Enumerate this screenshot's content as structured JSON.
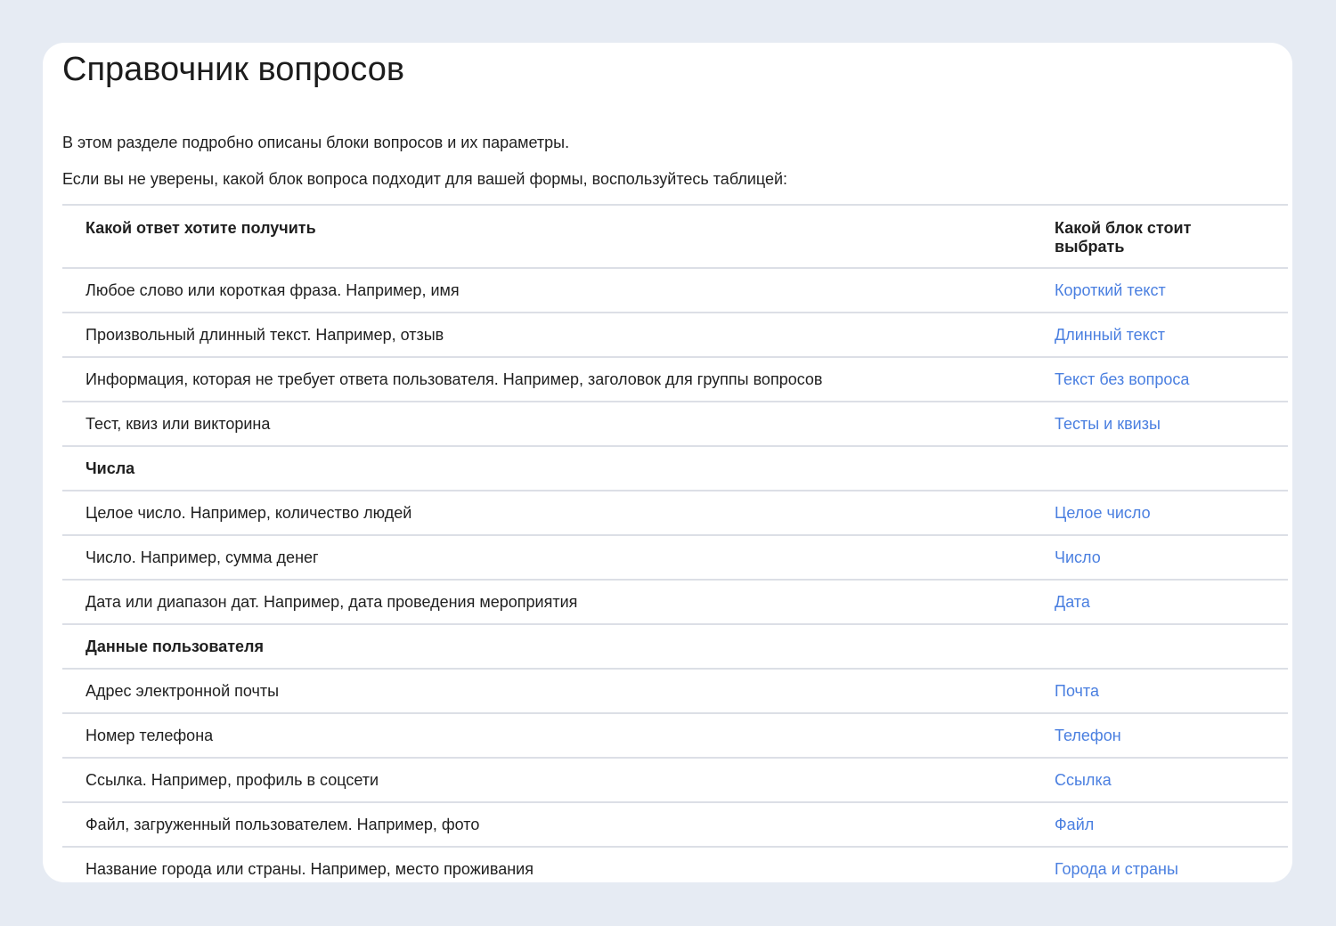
{
  "page": {
    "title": "Справочник вопросов",
    "intro": "В этом разделе подробно описаны блоки вопросов и их параметры.",
    "hint": "Если вы не уверены, какой блок вопроса подходит для вашей формы, воспользуйтесь таблицей:"
  },
  "table": {
    "headers": [
      "Какой ответ хотите получить",
      "Какой блок стоит выбрать"
    ],
    "rows": [
      {
        "answer": "Любое слово или короткая фраза. Например, имя",
        "block": "Короткий текст"
      },
      {
        "answer": "Произвольный длинный текст. Например, отзыв",
        "block": "Длинный текст"
      },
      {
        "answer": "Информация, которая не требует ответа пользователя. Например, заголовок для группы вопросов",
        "block": "Текст без вопроса"
      },
      {
        "answer": "Тест, квиз или викторина",
        "block": "Тесты и квизы"
      },
      {
        "section": "Числа"
      },
      {
        "answer": "Целое число. Например, количество людей",
        "block": "Целое число"
      },
      {
        "answer": "Число. Например, сумма денег",
        "block": "Число"
      },
      {
        "answer": "Дата или диапазон дат. Например, дата проведения мероприятия",
        "block": "Дата"
      },
      {
        "section": "Данные пользователя"
      },
      {
        "answer": "Адрес электронной почты",
        "block": "Почта"
      },
      {
        "answer": "Номер телефона",
        "block": "Телефон"
      },
      {
        "answer": "Ссылка. Например, профиль в соцсети",
        "block": "Ссылка"
      },
      {
        "answer": "Файл, загруженный пользователем. Например, фото",
        "block": "Файл"
      },
      {
        "answer": "Название города или страны. Например, место проживания",
        "block": "Города и страны"
      }
    ]
  },
  "colors": {
    "link": "#4a7fe0",
    "background": "#e6ebf3",
    "divider": "#dcdfe6"
  }
}
